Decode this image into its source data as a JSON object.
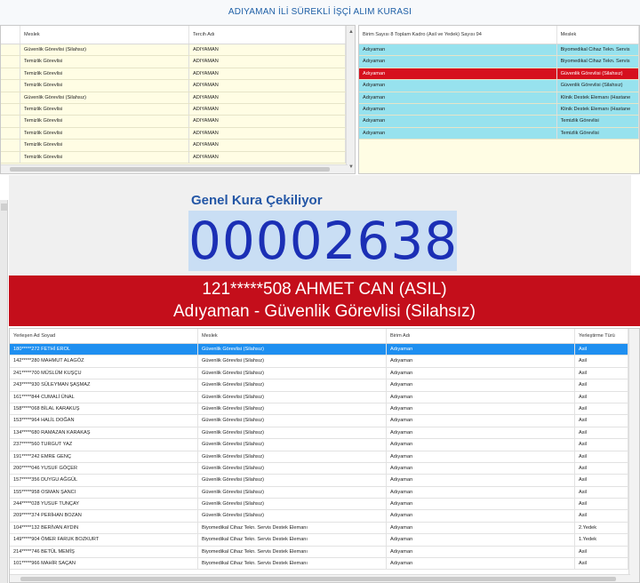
{
  "title": "ADIYAMAN İLİ SÜREKLİ İŞÇİ ALIM KURASI",
  "left_table": {
    "headers": [
      "Meslek",
      "Tercih Adı"
    ],
    "rows": [
      [
        "Güvenlik Görevlisi (Silahsız)",
        "ADIYAMAN"
      ],
      [
        "Temizlik Görevlisi",
        "ADIYAMAN"
      ],
      [
        "Temizlik Görevlisi",
        "ADIYAMAN"
      ],
      [
        "Temizlik Görevlisi",
        "ADIYAMAN"
      ],
      [
        "Güvenlik Görevlisi (Silahsız)",
        "ADIYAMAN"
      ],
      [
        "Temizlik Görevlisi",
        "ADIYAMAN"
      ],
      [
        "Temizlik Görevlisi",
        "ADIYAMAN"
      ],
      [
        "Temizlik Görevlisi",
        "ADIYAMAN"
      ],
      [
        "Temizlik Görevlisi",
        "ADIYAMAN"
      ],
      [
        "Temizlik Görevlisi",
        "ADIYAMAN"
      ]
    ]
  },
  "right_table": {
    "headers": [
      "Birim Sayısı 8 Toplam Kadro (Asil ve Yedek) Sayısı 94",
      "Meslek"
    ],
    "rows": [
      [
        "Adıyaman",
        "Biyomedikal Cihaz Tekn. Servis"
      ],
      [
        "Adıyaman",
        "Biyomedikal Cihaz Tekn. Servis"
      ],
      [
        "Adıyaman",
        "Güvenlik Görevlisi (Silahsız)"
      ],
      [
        "Adıyaman",
        "Güvenlik Görevlisi (Silahsız)"
      ],
      [
        "Adıyaman",
        "Klinik Destek Elemanı (Hastane"
      ],
      [
        "Adıyaman",
        "Klinik Destek Elemanı (Hastane"
      ],
      [
        "Adıyaman",
        "Temizlik Görevlisi"
      ],
      [
        "Adıyaman",
        "Temizlik Görevlisi"
      ]
    ],
    "selected_index": 2
  },
  "draw": {
    "heading": "Genel Kura Çekiliyor",
    "number": "00002638",
    "winner_line1": "121*****508 AHMET CAN (ASIL)",
    "winner_line2": "Adıyaman - Güvenlik Görevlisi (Silahsız)"
  },
  "placed_table": {
    "headers": [
      "Yerleşen Ad Soyad",
      "Meslek",
      "Birim Adı",
      "Yerleştirme Türü"
    ],
    "rows": [
      [
        "180*****272 FETHİ EROL",
        "Güvenlik Görevlisi (Silahsız)",
        "Adıyaman",
        "Asil"
      ],
      [
        "142*****280 MAHMUT ALAGÖZ",
        "Güvenlik Görevlisi (Silahsız)",
        "Adıyaman",
        "Asil"
      ],
      [
        "241*****700 MÜSLÜM KUŞÇU",
        "Güvenlik Görevlisi (Silahsız)",
        "Adıyaman",
        "Asil"
      ],
      [
        "243*****930 SÜLEYMAN ŞAŞMAZ",
        "Güvenlik Görevlisi (Silahsız)",
        "Adıyaman",
        "Asil"
      ],
      [
        "161*****844 CUMALİ ÜNAL",
        "Güvenlik Görevlisi (Silahsız)",
        "Adıyaman",
        "Asil"
      ],
      [
        "158*****068 BİLAL KARAKUŞ",
        "Güvenlik Görevlisi (Silahsız)",
        "Adıyaman",
        "Asil"
      ],
      [
        "153*****964 HALİL DOĞAN",
        "Güvenlik Görevlisi (Silahsız)",
        "Adıyaman",
        "Asil"
      ],
      [
        "134*****680 RAMAZAN KARAKAŞ",
        "Güvenlik Görevlisi (Silahsız)",
        "Adıyaman",
        "Asil"
      ],
      [
        "237*****560 TURGUT YAZ",
        "Güvenlik Görevlisi (Silahsız)",
        "Adıyaman",
        "Asil"
      ],
      [
        "191*****242 EMRE GENÇ",
        "Güvenlik Görevlisi (Silahsız)",
        "Adıyaman",
        "Asil"
      ],
      [
        "200*****046 YUSUF GÖÇER",
        "Güvenlik Görevlisi (Silahsız)",
        "Adıyaman",
        "Asil"
      ],
      [
        "157*****356 DUYGU AĞGÜL",
        "Güvenlik Görevlisi (Silahsız)",
        "Adıyaman",
        "Asil"
      ],
      [
        "155*****958 OSMAN ŞANCI",
        "Güvenlik Görevlisi (Silahsız)",
        "Adıyaman",
        "Asil"
      ],
      [
        "244*****028 YUSUF TUNÇAY",
        "Güvenlik Görevlisi (Silahsız)",
        "Adıyaman",
        "Asil"
      ],
      [
        "209*****374 PERİHAN BOZAN",
        "Güvenlik Görevlisi (Silahsız)",
        "Adıyaman",
        "Asil"
      ],
      [
        "104*****132 BERİVAN AYDIN",
        "Biyomedikal Cihaz Tekn. Servis Destek Elemanı",
        "Adıyaman",
        "2.Yedek"
      ],
      [
        "149*****904 ÖMER FARUK BOZKURT",
        "Biyomedikal Cihaz Tekn. Servis Destek Elemanı",
        "Adıyaman",
        "1.Yedek"
      ],
      [
        "214*****746 BETÜL MEMİŞ",
        "Biyomedikal Cihaz Tekn. Servis Destek Elemanı",
        "Adıyaman",
        "Asil"
      ],
      [
        "101*****966 MAHİR SAÇAN",
        "Biyomedikal Cihaz Tekn. Servis Destek Elemanı",
        "Adıyaman",
        "Asil"
      ]
    ],
    "selected_index": 0
  },
  "colors": {
    "selected_red": "#d6101e",
    "cyan_row": "#97e2ee",
    "yellow_row": "#fffde4",
    "selected_blue": "#1e8ff0",
    "counter_blue": "#1b2fb5",
    "banner_red": "#c40e1b"
  }
}
